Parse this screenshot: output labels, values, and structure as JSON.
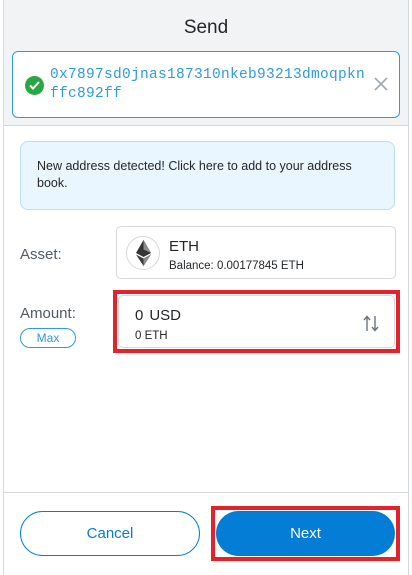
{
  "header": {
    "title": "Send",
    "recipient_address": "0x7897sd0jnas187310nkeb93213dmoqpknffc892ff"
  },
  "notice": {
    "text": "New address detected! Click here to add to your address book."
  },
  "asset": {
    "label": "Asset:",
    "symbol": "ETH",
    "balance": "Balance: 0.00177845 ETH",
    "icon": "ethereum-icon"
  },
  "amount": {
    "label": "Amount:",
    "max_label": "Max",
    "fiat_value": "0",
    "fiat_currency": "USD",
    "crypto_value": "0 ETH"
  },
  "footer": {
    "cancel_label": "Cancel",
    "next_label": "Next"
  },
  "colors": {
    "accent": "#037dd6",
    "link_blue": "#2f9ae0",
    "success": "#28a745",
    "highlight": "#e3222b",
    "notice_bg": "#eaf6ff"
  }
}
